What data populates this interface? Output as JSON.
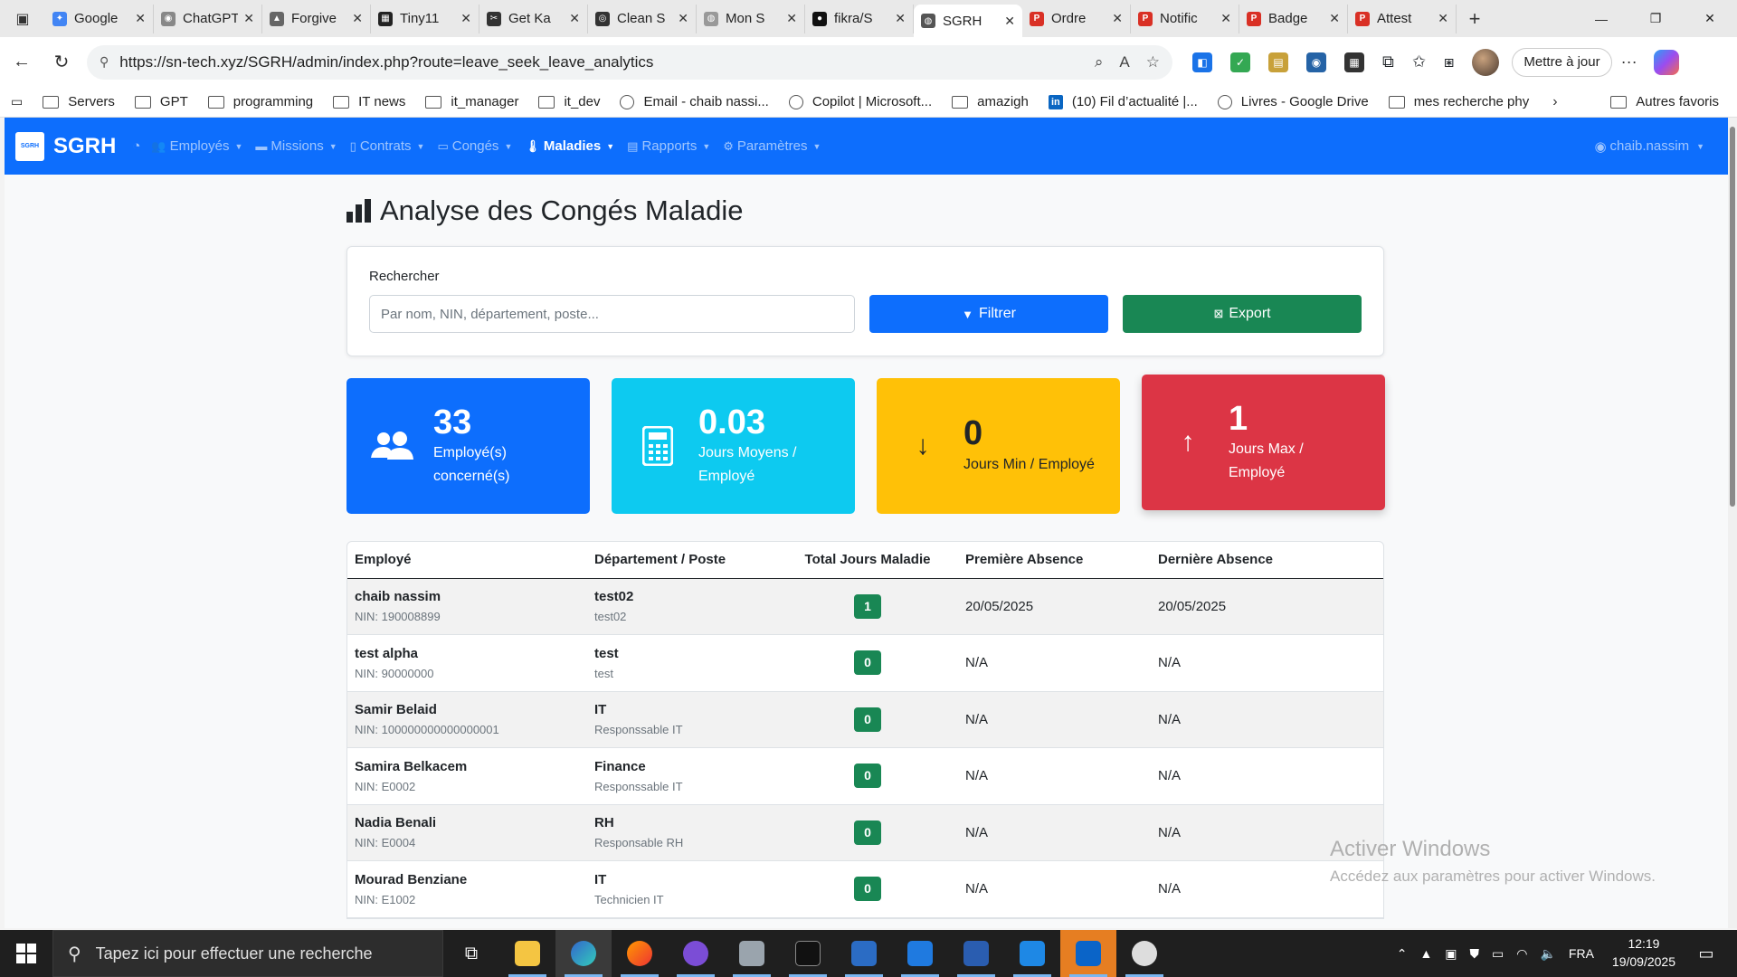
{
  "browser": {
    "tabs": [
      {
        "title": "Google",
        "color": "#4285f4",
        "glyph": "✦"
      },
      {
        "title": "ChatGPT",
        "color": "#888888",
        "glyph": "◉"
      },
      {
        "title": "Forgive",
        "color": "#666666",
        "glyph": "▲"
      },
      {
        "title": "Tiny11",
        "color": "#222222",
        "glyph": "▦"
      },
      {
        "title": "Get Ka",
        "color": "#333333",
        "glyph": "✂"
      },
      {
        "title": "Clean S",
        "color": "#333333",
        "glyph": "◎"
      },
      {
        "title": "Mon S",
        "color": "#999999",
        "glyph": "◍"
      },
      {
        "title": "fikra/S",
        "color": "#111111",
        "glyph": "●"
      },
      {
        "title": "SGRH",
        "color": "#555555",
        "glyph": "◍"
      },
      {
        "title": "Ordre",
        "color": "#d93025",
        "glyph": "P"
      },
      {
        "title": "Notific",
        "color": "#d93025",
        "glyph": "P"
      },
      {
        "title": "Badge",
        "color": "#d93025",
        "glyph": "P"
      },
      {
        "title": "Attest",
        "color": "#d93025",
        "glyph": "P"
      }
    ],
    "active_tab_index": 8,
    "url": "https://sn-tech.xyz/SGRH/admin/index.php?route=leave_seek_leave_analytics",
    "update_button": "Mettre à jour",
    "bookmarks": [
      {
        "label": "Servers",
        "type": "folder"
      },
      {
        "label": "GPT",
        "type": "folder"
      },
      {
        "label": "programming",
        "type": "folder"
      },
      {
        "label": "IT news",
        "type": "folder"
      },
      {
        "label": "it_manager",
        "type": "folder"
      },
      {
        "label": "it_dev",
        "type": "folder"
      },
      {
        "label": "Email - chaib nassi...",
        "type": "globe"
      },
      {
        "label": "Copilot | Microsoft...",
        "type": "globe"
      },
      {
        "label": "amazigh",
        "type": "folder"
      },
      {
        "label": "(10) Fil d’actualité |...",
        "type": "linkedin"
      },
      {
        "label": "Livres - Google Drive",
        "type": "globe"
      },
      {
        "label": "mes recherche phy",
        "type": "folder"
      }
    ],
    "other_bookmarks": "Autres favoris"
  },
  "app": {
    "brand": "SGRH",
    "logo_text": "SGRH",
    "nav": [
      {
        "label": "Employés",
        "icon": "users-icon",
        "active": false
      },
      {
        "label": "Missions",
        "icon": "briefcase-icon",
        "active": false
      },
      {
        "label": "Contrats",
        "icon": "file-icon",
        "active": false
      },
      {
        "label": "Congés",
        "icon": "calendar-icon",
        "active": false
      },
      {
        "label": "Maladies",
        "icon": "thermometer-icon",
        "active": true
      },
      {
        "label": "Rapports",
        "icon": "report-icon",
        "active": false
      },
      {
        "label": "Paramètres",
        "icon": "gear-icon",
        "active": false
      }
    ],
    "user": "chaib.nassim"
  },
  "page": {
    "title": "Analyse des Congés Maladie",
    "filter": {
      "label": "Rechercher",
      "placeholder": "Par nom, NIN, département, poste...",
      "value": "",
      "filter_button": "Filtrer",
      "export_button": "Export"
    },
    "stats": [
      {
        "value": "33",
        "label": "Employé(s) concerné(s)",
        "icon": "users-icon",
        "color": "#0d6efd"
      },
      {
        "value": "0.03",
        "label": "Jours Moyens / Employé",
        "icon": "calculator-icon",
        "color": "#0dcaf0"
      },
      {
        "value": "0",
        "label": "Jours Min / Employé",
        "icon": "arrow-down-icon",
        "color": "#ffc107"
      },
      {
        "value": "1",
        "label": "Jours Max / Employé",
        "icon": "arrow-up-icon",
        "color": "#dc3545"
      }
    ],
    "table": {
      "headers": [
        "Employé",
        "Département / Poste",
        "Total Jours Maladie",
        "Première Absence",
        "Dernière Absence"
      ],
      "rows": [
        {
          "name": "chaib nassim",
          "nin": "NIN: 190008899",
          "dept": "test02",
          "poste": "test02",
          "days": "1",
          "first": "20/05/2025",
          "last": "20/05/2025"
        },
        {
          "name": "test alpha",
          "nin": "NIN: 90000000",
          "dept": "test",
          "poste": "test",
          "days": "0",
          "first": "N/A",
          "last": "N/A"
        },
        {
          "name": "Samir Belaid",
          "nin": "NIN: 100000000000000001",
          "dept": "IT",
          "poste": "Responssable IT",
          "days": "0",
          "first": "N/A",
          "last": "N/A"
        },
        {
          "name": "Samira Belkacem",
          "nin": "NIN: E0002",
          "dept": "Finance",
          "poste": "Responssable IT",
          "days": "0",
          "first": "N/A",
          "last": "N/A"
        },
        {
          "name": "Nadia Benali",
          "nin": "NIN: E0004",
          "dept": "RH",
          "poste": "Responsable RH",
          "days": "0",
          "first": "N/A",
          "last": "N/A"
        },
        {
          "name": "Mourad Benziane",
          "nin": "NIN: E1002",
          "dept": "IT",
          "poste": "Technicien IT",
          "days": "0",
          "first": "N/A",
          "last": "N/A"
        }
      ]
    }
  },
  "watermark": {
    "line1": "Activer Windows",
    "line2": "Accédez aux paramètres pour activer Windows."
  },
  "taskbar": {
    "search_placeholder": "Tapez ici pour effectuer une recherche",
    "language": "FRA",
    "time": "12:19",
    "date": "19/09/2025"
  }
}
